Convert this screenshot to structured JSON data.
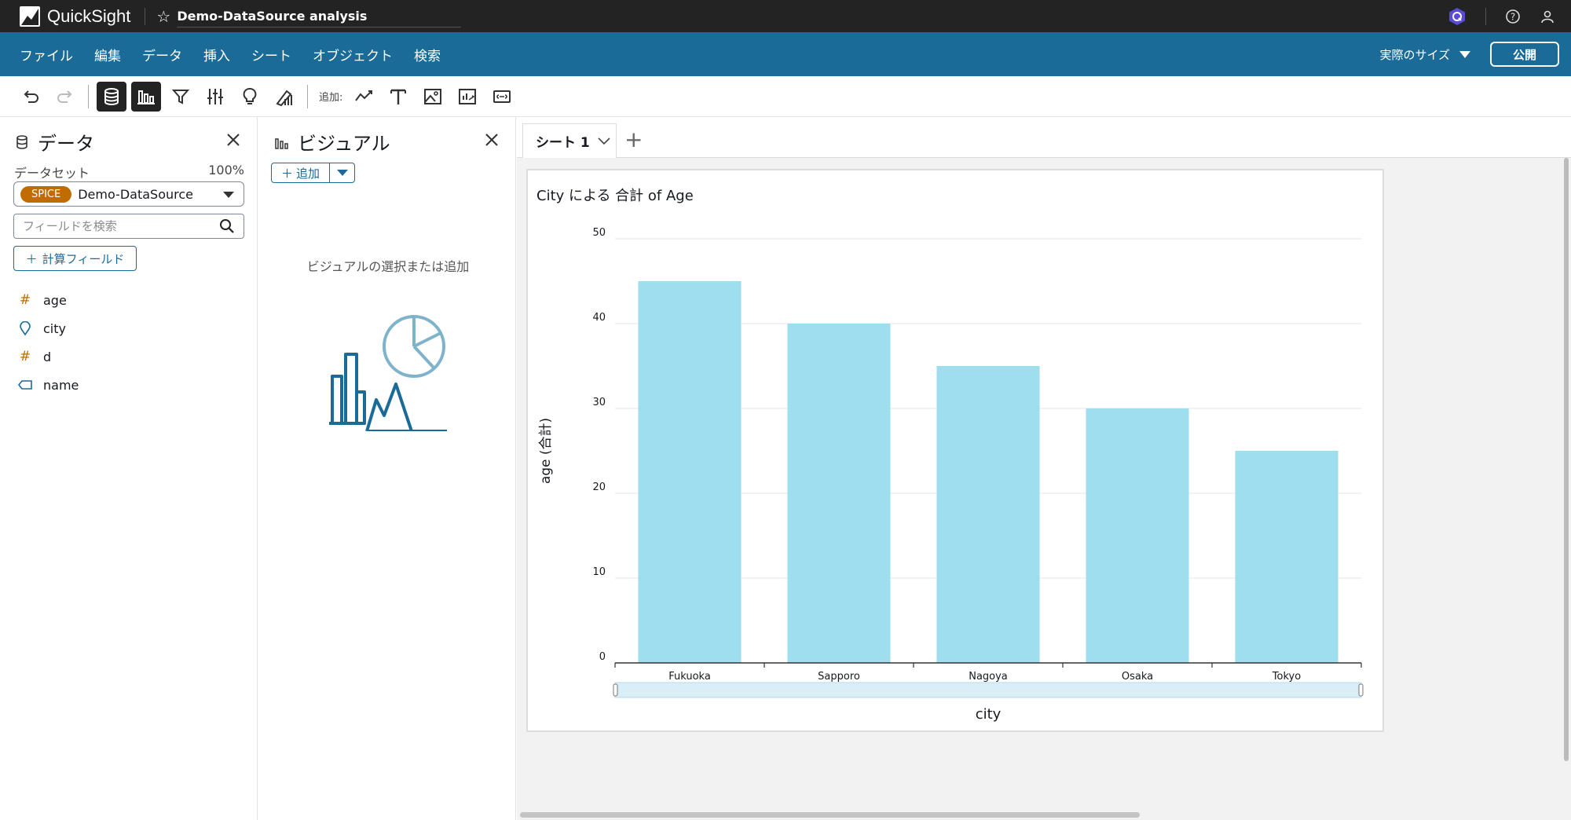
{
  "app": {
    "name": "QuickSight",
    "analysis_title": "Demo-DataSource analysis"
  },
  "menu": {
    "items": [
      "ファイル",
      "編集",
      "データ",
      "挿入",
      "シート",
      "オブジェクト",
      "検索"
    ],
    "size_label": "実際のサイズ",
    "publish_label": "公開"
  },
  "toolbar": {
    "add_label": "追加:"
  },
  "data_panel": {
    "title": "データ",
    "dataset_label": "データセット",
    "dataset_percent": "100%",
    "spice_badge": "SPICE",
    "dataset_name": "Demo-DataSource",
    "search_placeholder": "フィールドを検索",
    "calc_field_label": "計算フィールド",
    "fields": [
      {
        "name": "age",
        "icon": "hash-icon",
        "kind": "measure"
      },
      {
        "name": "city",
        "icon": "location-pin-icon",
        "kind": "dim"
      },
      {
        "name": "d",
        "icon": "hash-icon",
        "kind": "measure"
      },
      {
        "name": "name",
        "icon": "tag-icon",
        "kind": "dim"
      }
    ]
  },
  "visual_panel": {
    "title": "ビジュアル",
    "add_label": "追加",
    "empty_text": "ビジュアルの選択または追加"
  },
  "sheet": {
    "tab_label": "シート 1"
  },
  "colors": {
    "bar": "#9fdeef",
    "menu_bg": "#1a6b97",
    "top_bg": "#232323",
    "spice": "#c16c00"
  },
  "chart_data": {
    "type": "bar",
    "title": "City による 合計 of Age",
    "xlabel": "city",
    "ylabel": "age (合計)",
    "categories": [
      "Fukuoka",
      "Sapporo",
      "Nagoya",
      "Osaka",
      "Tokyo"
    ],
    "values": [
      45,
      40,
      35,
      30,
      25
    ],
    "ylim": [
      0,
      50
    ],
    "yticks": [
      0,
      10,
      20,
      30,
      40,
      50
    ],
    "grid": true
  }
}
